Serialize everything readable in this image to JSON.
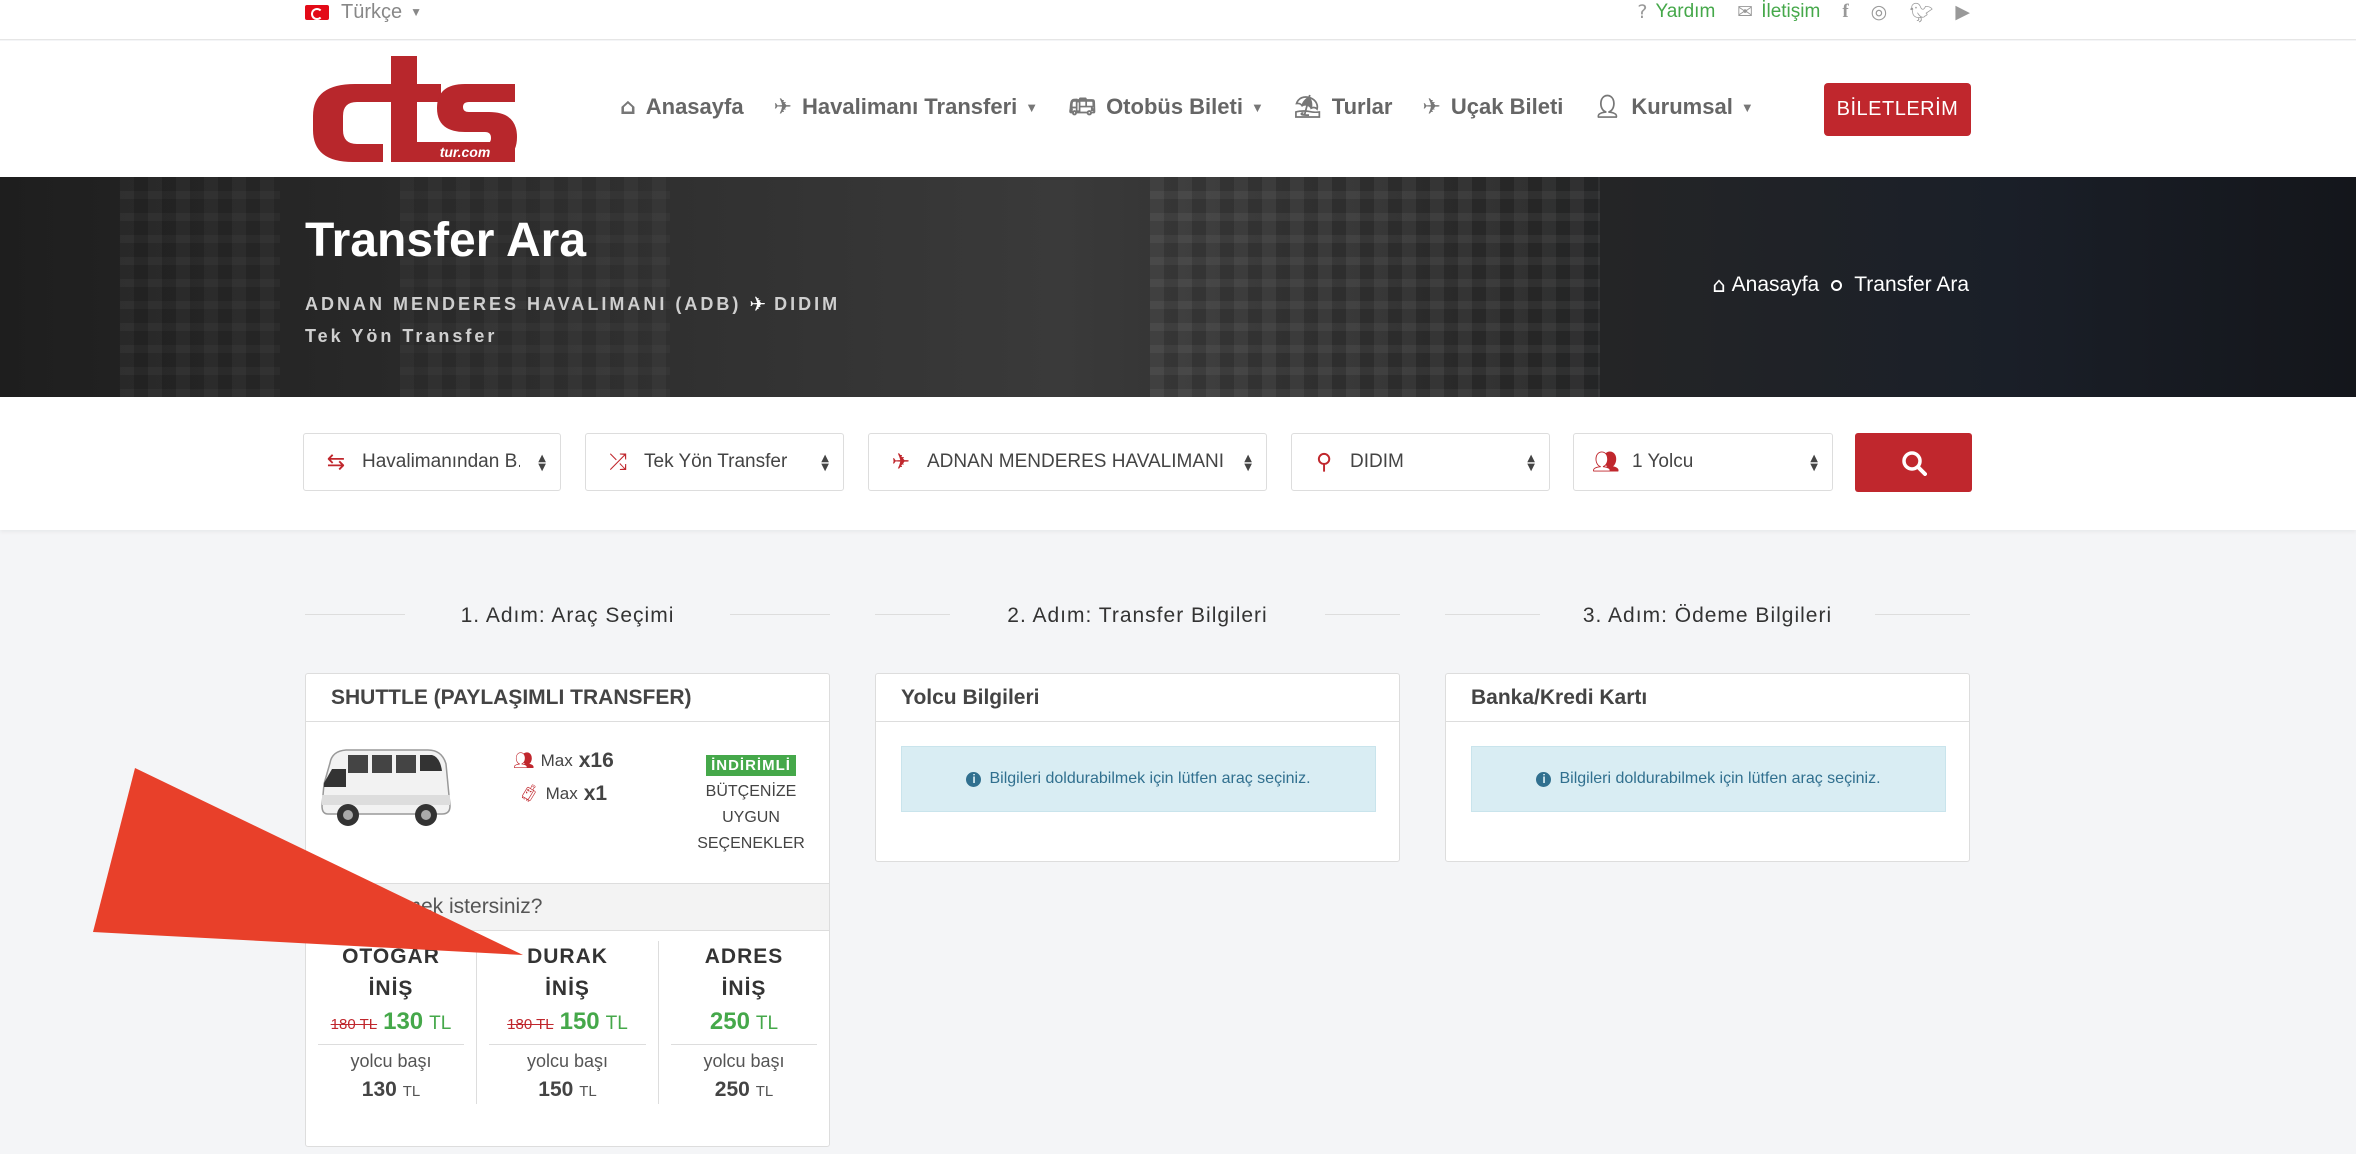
{
  "topbar": {
    "language": "Türkçe",
    "help": "Yardım",
    "contact": "İletişim",
    "socials": [
      "facebook-icon",
      "instagram-icon",
      "twitter-icon",
      "youtube-icon"
    ]
  },
  "header": {
    "logo_text": "cts",
    "logo_sub": "tur.com",
    "nav": [
      {
        "label": "Anasayfa",
        "icon": "home-icon"
      },
      {
        "label": "Havalimanı Transferi",
        "icon": "plane-icon",
        "caret": true
      },
      {
        "label": "Otobüs Bileti",
        "icon": "bus-icon",
        "caret": true
      },
      {
        "label": "Turlar",
        "icon": "umbrella-beach-icon"
      },
      {
        "label": "Uçak Bileti",
        "icon": "plane-icon"
      },
      {
        "label": "Kurumsal",
        "icon": "user-icon",
        "caret": true
      }
    ],
    "tickets_button": "BİLETLERİM"
  },
  "hero": {
    "title": "Transfer Ara",
    "from": "ADNAN MENDERES HAVALIMANI (ADB)",
    "to": "DIDIM",
    "subtitle": "Tek Yön Transfer",
    "breadcrumb_home": "Anasayfa",
    "breadcrumb_current": "Transfer Ara"
  },
  "search": {
    "direction": "Havalimanından B...",
    "trip_type": "Tek Yön Transfer",
    "airport": "ADNAN MENDERES HAVALIMANI (...",
    "destination": "DIDIM",
    "passengers": "1 Yolcu"
  },
  "steps": {
    "step1": "1. Adım: Araç Seçimi",
    "step2": "2. Adım: Transfer Bilgileri",
    "step3": "3. Adım: Ödeme Bilgileri"
  },
  "vehicle": {
    "title": "SHUTTLE (PAYLAŞIMLI TRANSFER)",
    "max_label": "Max",
    "passengers_max": "x16",
    "luggage_max": "x1",
    "badge": "İNDİRİMLİ",
    "badge_text_1": "BÜTÇENİZE",
    "badge_text_2": "UYGUN",
    "badge_text_3": "SEÇENEKLER",
    "question": "...mek istersiniz?",
    "currency": "TL",
    "per_person": "yolcu başı",
    "options": [
      {
        "line1": "OTOGAR",
        "line2": "İNİŞ",
        "old": "180 TL",
        "price": "130",
        "per": "130"
      },
      {
        "line1": "DURAK",
        "line2": "İNİŞ",
        "old": "180 TL",
        "price": "150",
        "per": "150"
      },
      {
        "line1": "ADRES",
        "line2": "İNİŞ",
        "old": "",
        "price": "250",
        "per": "250"
      }
    ]
  },
  "passenger_card": {
    "title": "Yolcu Bilgileri",
    "info": "Bilgileri doldurabilmek için lütfen araç seçiniz."
  },
  "payment_card": {
    "title": "Banka/Kredi Kartı",
    "info": "Bilgileri doldurabilmek için lütfen araç seçiniz."
  },
  "colors": {
    "brand": "#c0272d",
    "success": "#45a84a",
    "annotation_arrow": "#e8402a"
  }
}
